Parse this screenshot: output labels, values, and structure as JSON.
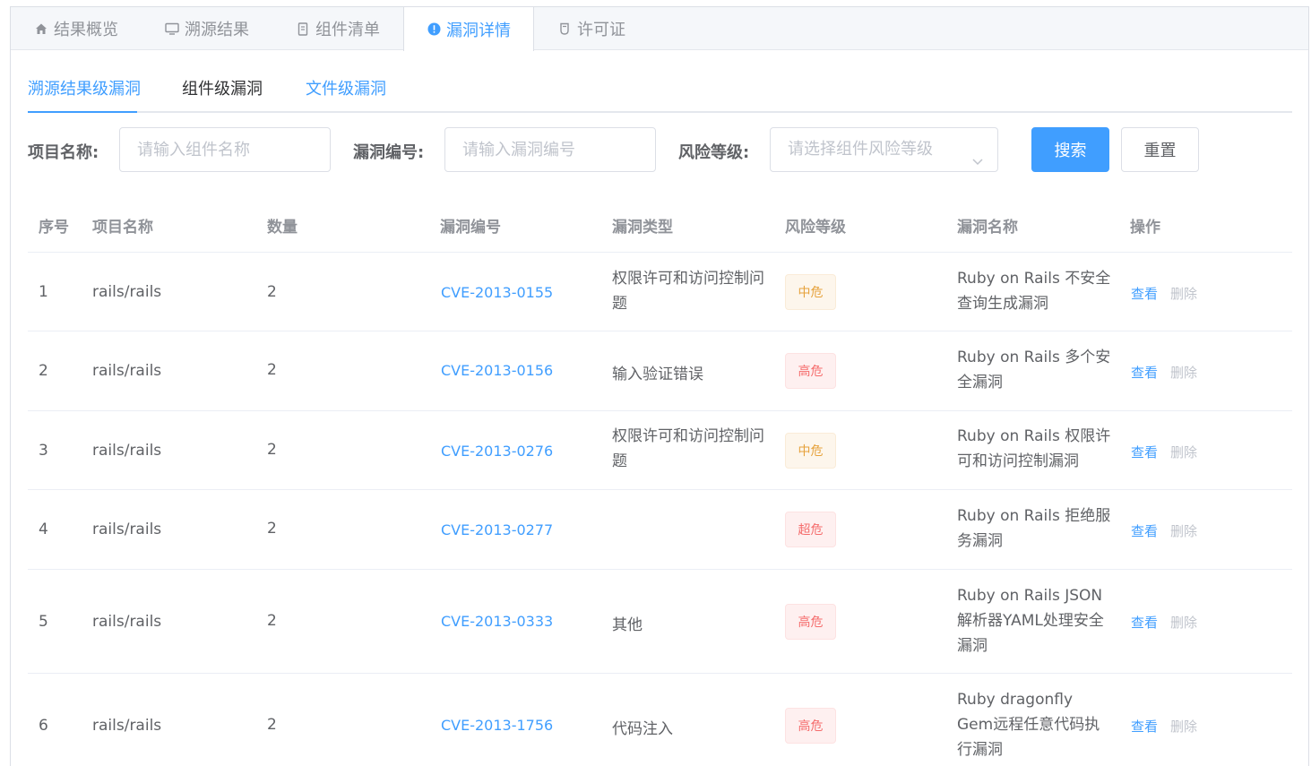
{
  "top_tabs": [
    {
      "label": "结果概览",
      "icon": "home-icon"
    },
    {
      "label": "溯源结果",
      "icon": "monitor-icon"
    },
    {
      "label": "组件清单",
      "icon": "document-icon"
    },
    {
      "label": "漏洞详情",
      "icon": "warning-circle-icon",
      "active": true
    },
    {
      "label": "许可证",
      "icon": "cup-icon"
    }
  ],
  "sub_tabs": [
    {
      "label": "溯源结果级漏洞",
      "active": true
    },
    {
      "label": "组件级漏洞"
    },
    {
      "label": "文件级漏洞"
    }
  ],
  "filters": {
    "project_label": "项目名称:",
    "project_placeholder": "请输入组件名称",
    "vuln_label": "漏洞编号:",
    "vuln_placeholder": "请输入漏洞编号",
    "risk_label": "风险等级:",
    "risk_placeholder": "请选择组件风险等级",
    "search_button": "搜索",
    "reset_button": "重置"
  },
  "table": {
    "headers": {
      "index": "序号",
      "project": "项目名称",
      "count": "数量",
      "cve": "漏洞编号",
      "type": "漏洞类型",
      "risk": "风险等级",
      "name": "漏洞名称",
      "ops": "操作"
    },
    "view_label": "查看",
    "delete_label": "删除",
    "rows": [
      {
        "index": "1",
        "project": "rails/rails",
        "count": "2",
        "cve": "CVE-2013-0155",
        "type": "权限许可和访问控制问题",
        "risk": "中危",
        "risk_level": "mid",
        "name": "Ruby on Rails 不安全查询生成漏洞"
      },
      {
        "index": "2",
        "project": "rails/rails",
        "count": "2",
        "cve": "CVE-2013-0156",
        "type": "输入验证错误",
        "risk": "高危",
        "risk_level": "high",
        "name": "Ruby on Rails 多个安全漏洞"
      },
      {
        "index": "3",
        "project": "rails/rails",
        "count": "2",
        "cve": "CVE-2013-0276",
        "type": "权限许可和访问控制问题",
        "risk": "中危",
        "risk_level": "mid",
        "name": "Ruby on Rails 权限许可和访问控制漏洞"
      },
      {
        "index": "4",
        "project": "rails/rails",
        "count": "2",
        "cve": "CVE-2013-0277",
        "type": "",
        "risk": "超危",
        "risk_level": "super",
        "name": "Ruby on Rails 拒绝服务漏洞"
      },
      {
        "index": "5",
        "project": "rails/rails",
        "count": "2",
        "cve": "CVE-2013-0333",
        "type": "其他",
        "risk": "高危",
        "risk_level": "high",
        "name": "Ruby on Rails JSON解析器YAML处理安全漏洞"
      },
      {
        "index": "6",
        "project": "rails/rails",
        "count": "2",
        "cve": "CVE-2013-1756",
        "type": "代码注入",
        "risk": "高危",
        "risk_level": "high",
        "name": "Ruby dragonfly Gem远程任意代码执行漏洞"
      }
    ]
  }
}
